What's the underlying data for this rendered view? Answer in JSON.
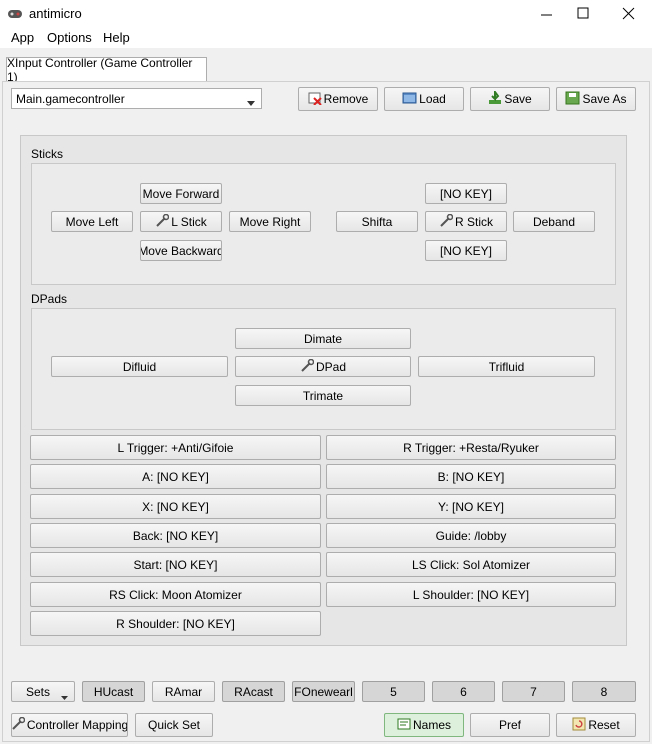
{
  "window": {
    "title": "antimicro"
  },
  "menu": {
    "app": "App",
    "options": "Options",
    "help": "Help"
  },
  "tab": {
    "label": "XInput Controller (Game Controller 1)"
  },
  "profile": {
    "selected": "Main.gamecontroller"
  },
  "toolbar": {
    "remove": "Remove",
    "load": "Load",
    "save": "Save",
    "save_as": "Save As"
  },
  "sticks": {
    "section_label": "Sticks",
    "left": {
      "up": "Move Forward",
      "left": "Move Left",
      "center": "L Stick",
      "right": "Move Right",
      "down": "Move Backward"
    },
    "right": {
      "up": "[NO KEY]",
      "left": "Shifta",
      "center": "R Stick",
      "right": "Deband",
      "down": "[NO KEY]"
    }
  },
  "dpads": {
    "section_label": "DPads",
    "up": "Dimate",
    "left": "Difluid",
    "center": "DPad",
    "right": "Trifluid",
    "down": "Trimate"
  },
  "buttons": {
    "left": [
      "L Trigger: +Anti/Gifoie",
      "A: [NO KEY]",
      "X: [NO KEY]",
      "Back: [NO KEY]",
      "Start: [NO KEY]",
      "RS Click: Moon Atomizer",
      "R Shoulder: [NO KEY]"
    ],
    "right": [
      "R Trigger: +Resta/Ryuker",
      "B: [NO KEY]",
      "Y: [NO KEY]",
      "Guide: /lobby",
      "LS Click: Sol Atomizer",
      "L Shoulder: [NO KEY]"
    ]
  },
  "sets": {
    "menu_label": "Sets",
    "items": [
      "HUcast",
      "RAmar",
      "RAcast",
      "FOnewearl",
      "5",
      "6",
      "7",
      "8"
    ]
  },
  "bottom": {
    "controller_mapping": "Controller Mapping",
    "quick_set": "Quick Set",
    "names": "Names",
    "pref": "Pref",
    "reset": "Reset"
  },
  "colors": {
    "active_set": "#f6f6f6",
    "inactive_set": "#d6d6d6"
  }
}
